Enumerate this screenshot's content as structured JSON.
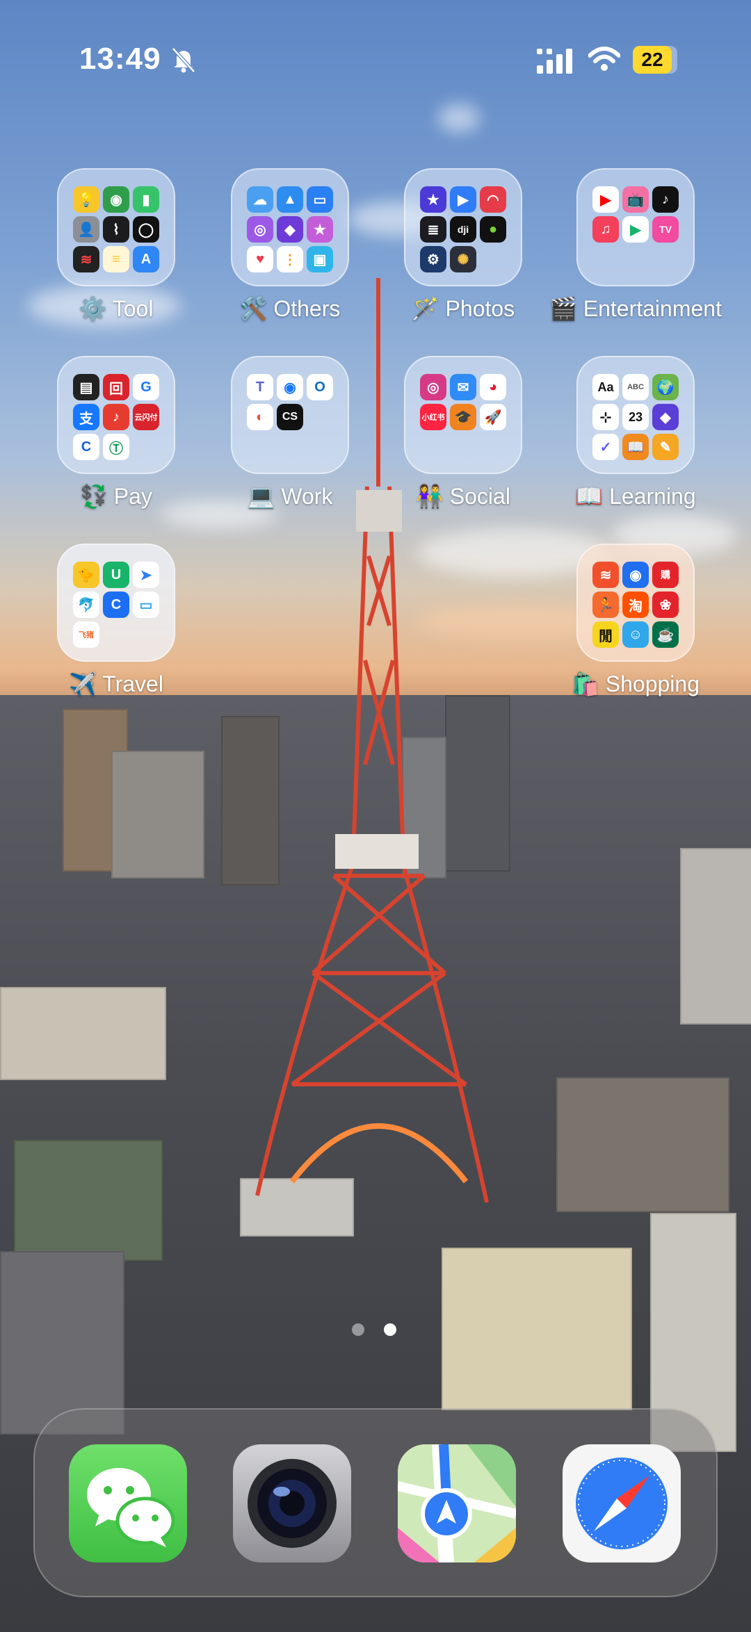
{
  "status": {
    "time": "13:49",
    "battery": "22",
    "silent_icon": "bell-slash-icon",
    "signal_icon": "cellular-signal-icon",
    "wifi_icon": "wifi-icon"
  },
  "folders": [
    {
      "label": "⚙️ Tool"
    },
    {
      "label": "🛠️ Others"
    },
    {
      "label": "🪄 Photos"
    },
    {
      "label": "🎬 Entertainment"
    },
    {
      "label": "💱 Pay"
    },
    {
      "label": "💻 Work"
    },
    {
      "label": "👫 Social"
    },
    {
      "label": "📖 Learning"
    },
    {
      "label": "✈️ Travel"
    },
    {
      "label": "🛍️ Shopping"
    }
  ],
  "mini_text": {
    "learning_aa": "Aa",
    "learning_abc": "ABC",
    "learning_date": "23",
    "work_cs": "CS",
    "social_xhs": "小红书",
    "ent_tv": "TV",
    "pay_payment": "云闪付",
    "travel_tag": "飞猪"
  },
  "dock": [
    {
      "name": "WeChat",
      "icon": "wechat-icon"
    },
    {
      "name": "Camera",
      "icon": "camera-lens-icon"
    },
    {
      "name": "Maps",
      "icon": "maps-icon"
    },
    {
      "name": "Safari",
      "icon": "safari-compass-icon"
    }
  ],
  "page_indicator": {
    "pages": 2,
    "current": 2
  },
  "colors": {
    "battery": "#ffd92e",
    "wechat": "#5ed05a",
    "safari": "#2f7cf6",
    "tower": "#d7432f"
  }
}
